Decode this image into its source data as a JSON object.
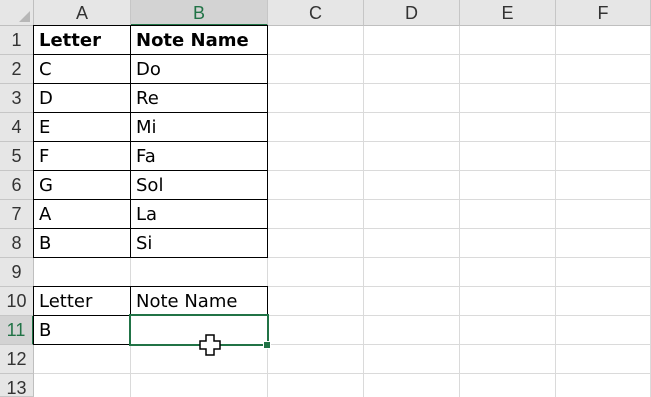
{
  "columns": [
    "A",
    "B",
    "C",
    "D",
    "E",
    "F"
  ],
  "rows": [
    "1",
    "2",
    "3",
    "4",
    "5",
    "6",
    "7",
    "8",
    "9",
    "10",
    "11",
    "12",
    "13"
  ],
  "selected_column": "B",
  "selected_row": "11",
  "table1": {
    "header": {
      "letter": "Letter",
      "note": "Note Name"
    },
    "rows": [
      {
        "letter": "C",
        "note": "Do"
      },
      {
        "letter": "D",
        "note": "Re"
      },
      {
        "letter": "E",
        "note": "Mi"
      },
      {
        "letter": "F",
        "note": "Fa"
      },
      {
        "letter": "G",
        "note": "Sol"
      },
      {
        "letter": "A",
        "note": "La"
      },
      {
        "letter": "B",
        "note": "Si"
      }
    ]
  },
  "table2": {
    "header": {
      "letter": "Letter",
      "note": "Note Name"
    },
    "row": {
      "letter": "B",
      "note": ""
    }
  },
  "cursor_icon": "excel-cell-select-cross",
  "accent_color": "#217346"
}
